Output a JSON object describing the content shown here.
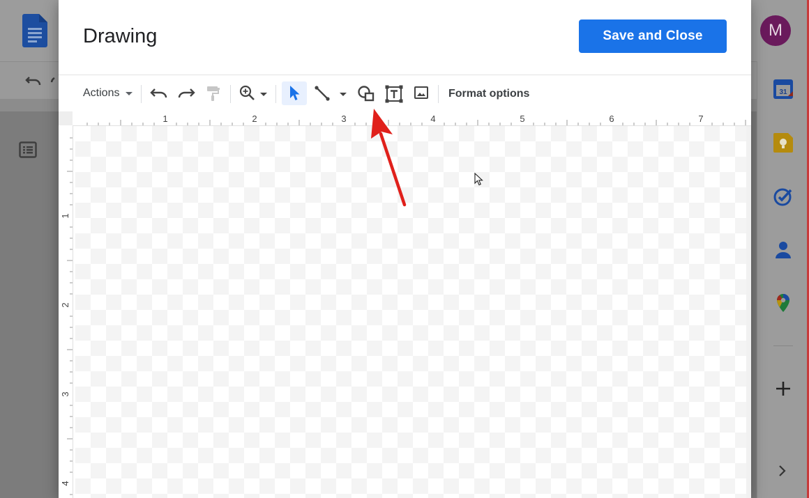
{
  "dialog": {
    "title": "Drawing",
    "save_label": "Save and Close"
  },
  "toolbar": {
    "actions_label": "Actions",
    "format_label": "Format options"
  },
  "ruler": {
    "horizontal": [
      "1",
      "2",
      "3",
      "4",
      "5",
      "6",
      "7"
    ],
    "vertical": [
      "1",
      "2",
      "3",
      "4"
    ]
  },
  "user": {
    "avatar_letter": "M"
  },
  "icons": {
    "side_panel": [
      "calendar-icon",
      "keep-icon",
      "tasks-icon",
      "contacts-icon",
      "maps-icon"
    ],
    "calendar_day": "31"
  },
  "colors": {
    "accent": "#1a73e8",
    "annotation": "#e0201b",
    "avatar": "#6a1a5c"
  }
}
